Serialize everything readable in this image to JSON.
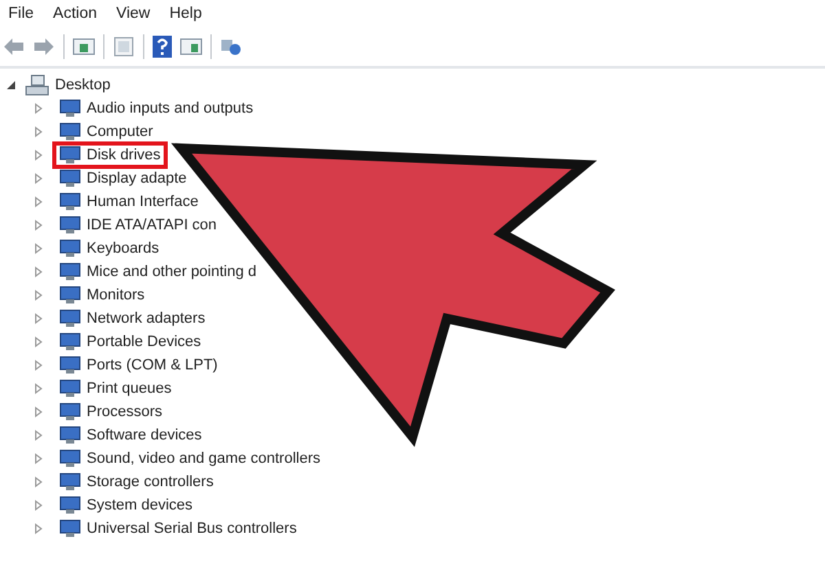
{
  "menu": [
    "File",
    "Action",
    "View",
    "Help"
  ],
  "tree": {
    "label": "Desktop",
    "expanded": true,
    "children": [
      {
        "label": "Audio inputs and outputs",
        "expanded": false,
        "highlighted": false
      },
      {
        "label": "Computer",
        "expanded": false,
        "highlighted": false
      },
      {
        "label": "Disk drives",
        "expanded": false,
        "highlighted": true
      },
      {
        "label": "Display adapte",
        "expanded": false,
        "highlighted": false
      },
      {
        "label": "Human Interface",
        "expanded": false,
        "highlighted": false
      },
      {
        "label": "IDE ATA/ATAPI con",
        "expanded": false,
        "highlighted": false
      },
      {
        "label": "Keyboards",
        "expanded": false,
        "highlighted": false
      },
      {
        "label": "Mice and other pointing d",
        "expanded": false,
        "highlighted": false
      },
      {
        "label": "Monitors",
        "expanded": false,
        "highlighted": false
      },
      {
        "label": "Network adapters",
        "expanded": false,
        "highlighted": false
      },
      {
        "label": "Portable Devices",
        "expanded": false,
        "highlighted": false
      },
      {
        "label": "Ports (COM & LPT)",
        "expanded": false,
        "highlighted": false
      },
      {
        "label": "Print queues",
        "expanded": false,
        "highlighted": false
      },
      {
        "label": "Processors",
        "expanded": false,
        "highlighted": false
      },
      {
        "label": "Software devices",
        "expanded": false,
        "highlighted": false
      },
      {
        "label": "Sound, video and game controllers",
        "expanded": false,
        "highlighted": false
      },
      {
        "label": "Storage controllers",
        "expanded": false,
        "highlighted": false
      },
      {
        "label": "System devices",
        "expanded": false,
        "highlighted": false
      },
      {
        "label": "Universal Serial Bus controllers",
        "expanded": false,
        "highlighted": false
      }
    ]
  }
}
